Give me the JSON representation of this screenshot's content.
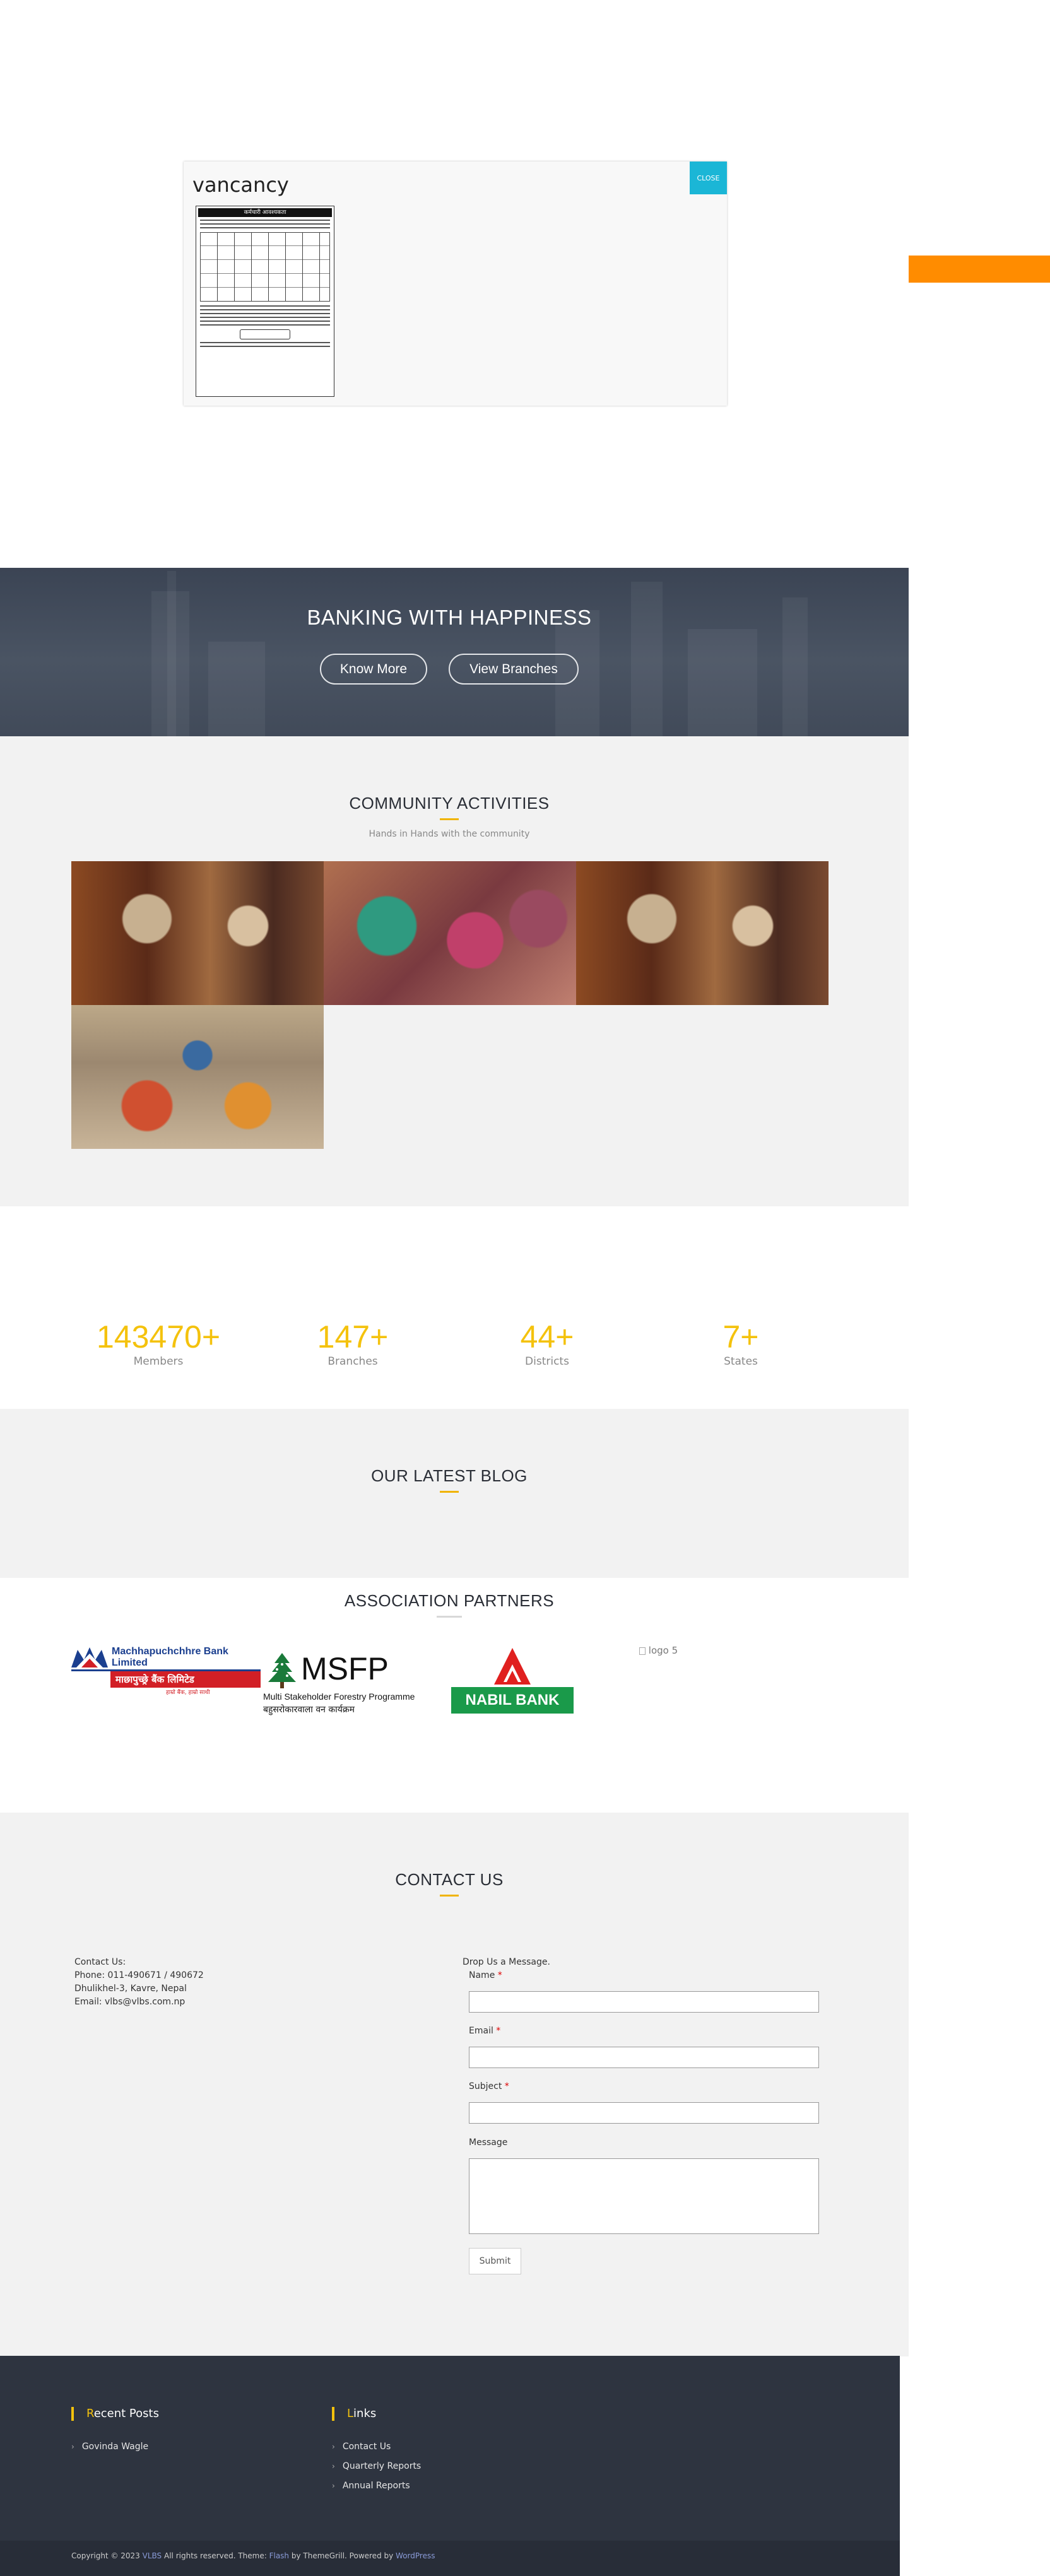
{
  "popup": {
    "title": "vancancy",
    "close_label": "CLOSE",
    "notice_heading": "कर्मचारी आवश्यकता"
  },
  "hero": {
    "title": "BANKING WITH HAPPINESS",
    "know_more": "Know More",
    "view_branches": "View Branches"
  },
  "community": {
    "title": "COMMUNITY ACTIVITIES",
    "subtitle": "Hands in Hands with the community"
  },
  "stats": [
    {
      "value": "143470",
      "suffix": "+",
      "label": "Members"
    },
    {
      "value": "147",
      "suffix": "+",
      "label": "Branches"
    },
    {
      "value": "44",
      "suffix": "+",
      "label": "Districts"
    },
    {
      "value": "7",
      "suffix": "+",
      "label": "States"
    }
  ],
  "blog": {
    "title": "OUR LATEST BLOG"
  },
  "partners": {
    "title": "ASSOCIATION PARTNERS",
    "machhapuchchhre_en": "Machhapuchchhre Bank Limited",
    "machhapuchchhre_np": "माछापुच्छ्रे बैंक लिमिटेड",
    "machhapuchchhre_tag": "हाम्रो बैंक, हाम्रो साथी",
    "msfp_name": "MSFP",
    "msfp_en": "Multi Stakeholder Forestry Programme",
    "msfp_np": "बहुसरोकारवाला वन कार्यक्रम",
    "nabil": "NABIL BANK",
    "logo5_alt": "logo 5"
  },
  "contact": {
    "title": "CONTACT US",
    "info_heading": "Contact Us:",
    "phone": "Phone: 011-490671 / 490672",
    "address": "Dhulikhel-3, Kavre, Nepal",
    "email": "Email: vlbs@vlbs.com.np",
    "form_heading": "Drop Us a Message.",
    "name_label": "Name",
    "email_label": "Email",
    "subject_label": "Subject",
    "message_label": "Message",
    "required_mark": "*",
    "submit": "Submit"
  },
  "footer": {
    "recent_posts_first": "R",
    "recent_posts_rest": "ecent Posts",
    "recent_posts": [
      "Govinda Wagle"
    ],
    "links_first": "L",
    "links_rest": "inks",
    "links": [
      "Contact Us",
      "Quarterly Reports",
      "Annual Reports"
    ],
    "copyright_pre": "Copyright © 2023",
    "copyright_site": "VLBS",
    "copyright_mid": "All rights reserved. Theme:",
    "theme_name": "Flash",
    "by_text": "by ThemeGrill. Powered by",
    "powered": "WordPress"
  },
  "colors": {
    "accent": "#f4c20d",
    "popup_close": "#1bb6d6",
    "side_tab": "#ff8c00",
    "footer_bg": "#2e3440"
  }
}
